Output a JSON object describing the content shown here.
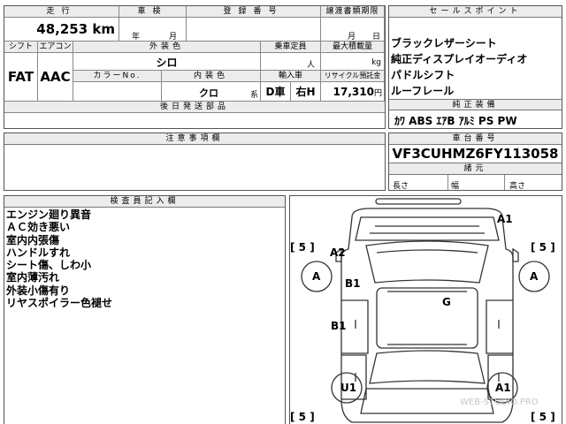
{
  "top_left": {
    "mileage_label": "走行",
    "mileage_value": "48,253 km",
    "inspection_label": "車検",
    "inspection_year": "年",
    "inspection_month": "月",
    "registration_label": "登録番号",
    "transfer_label": "譲渡書類期限",
    "transfer_month": "月",
    "transfer_day": "日",
    "shift_label": "シフト",
    "shift_value": "FAT",
    "ac_label": "エアコン",
    "ac_value": "AAC",
    "exterior_label": "外装色",
    "exterior_value": "シロ",
    "capacity_label": "乗車定員",
    "capacity_unit": "人",
    "max_load_label": "最大積載量",
    "max_load_unit": "kg",
    "color_no_label": "カラーNo.",
    "interior_label": "内装色",
    "interior_value": "クロ",
    "interior_suffix": "系",
    "import_label": "輸入車",
    "import_value": "D車",
    "handle_value": "右H",
    "recycle_label": "リサイクル預託金",
    "recycle_value": "17,310",
    "recycle_unit": "円",
    "later_docs_label": "後日発送部品"
  },
  "sales_points": {
    "header": "セールスポイント",
    "items": [
      "ブラックレザーシート",
      "純正ディスプレイオーディオ",
      "パドルシフト",
      "ルーフレール"
    ]
  },
  "genuine_equipment": {
    "header": "純正装備",
    "value": "ｶﾜ ABS ｴｱB ｱﾙﾐ PS PW"
  },
  "caution": {
    "header": "注意事項欄"
  },
  "chassis": {
    "header": "車台番号",
    "value": "VF3CUHMZ6FY113058",
    "dims_header": "諸元",
    "length_label": "長さ",
    "width_label": "幅",
    "height_label": "高さ"
  },
  "inspector": {
    "header": "検査員記入欄",
    "notes": [
      "エンジン廻り異音",
      "ＡＣ効き悪い",
      "室内内張傷",
      "ハンドルすれ",
      "シート傷、しわ小",
      "室内薄汚れ",
      "外装小傷有り",
      "リヤスポイラー色褪せ"
    ]
  },
  "diagram": {
    "marks": {
      "a1_top": "A1",
      "a2": "A2",
      "b1_upper": "B1",
      "g": "G",
      "b1_lower": "B1",
      "a_left": "A",
      "a_right": "A",
      "u1": "U1",
      "a1_bottom": "A1",
      "tire_tl": "[ 5 ]",
      "tire_tr": "[ 5 ]",
      "tire_bl": "[ 5 ]",
      "tire_br": "[ 5 ]"
    },
    "watermark": "WEB-STUDIO.PRO"
  }
}
